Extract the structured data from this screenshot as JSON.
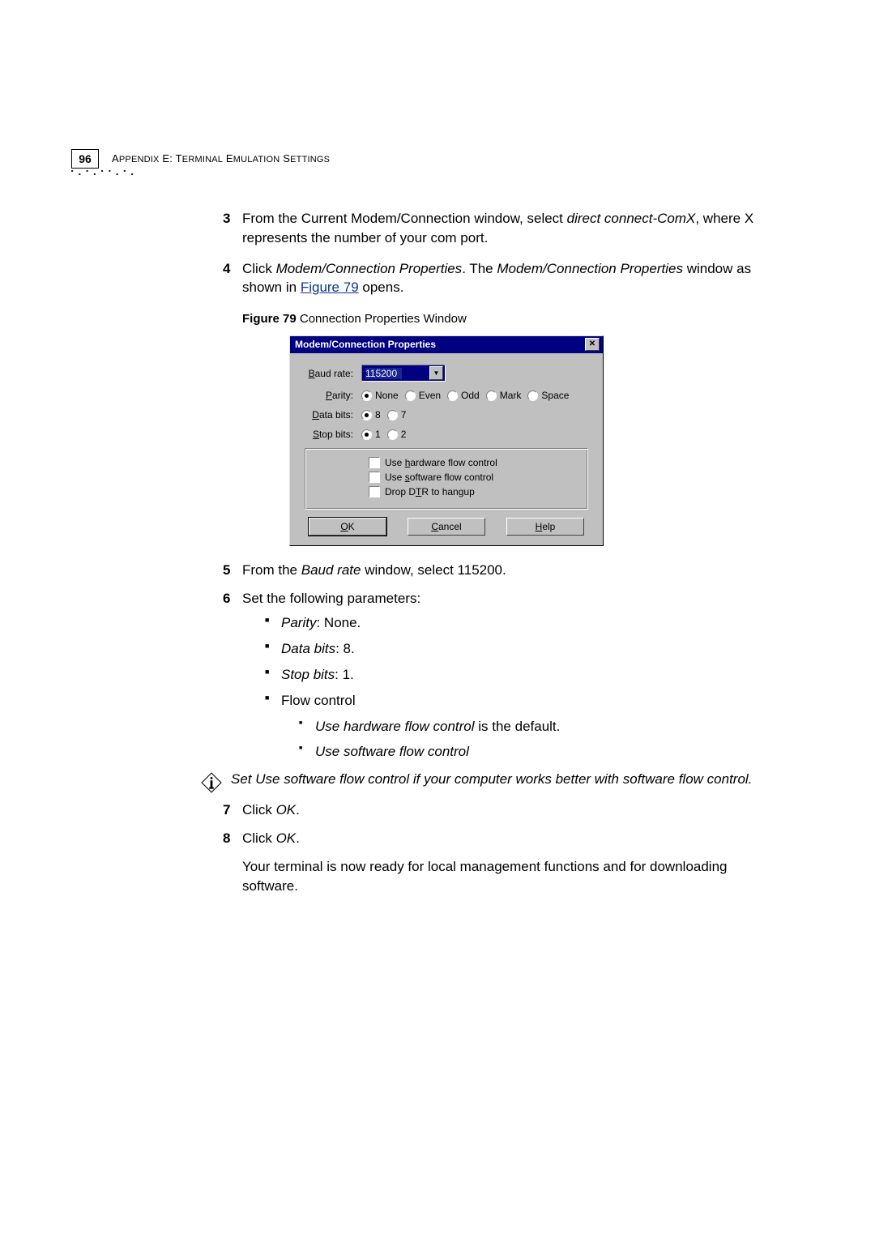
{
  "header": {
    "page_number": "96",
    "appendix_prefix": "A",
    "appendix_small": "PPENDIX",
    "appendix_letter": " E: T",
    "appendix_small2": "ERMINAL",
    "appendix_mid": " E",
    "appendix_small3": "MULATION",
    "appendix_mid2": " S",
    "appendix_small4": "ETTINGS"
  },
  "step3": {
    "prefix": "From the Current Modem/Connection window, select ",
    "italic": "direct connect-ComX",
    "suffix": ", where X represents the number of your com port."
  },
  "step4": {
    "prefix": "Click ",
    "italic1": "Modem/Connection Properties",
    "mid": ". The ",
    "italic2": "Modem/Connection Properties",
    "suffix1": " window as shown in ",
    "link": "Figure 79",
    "suffix2": " opens."
  },
  "figure": {
    "label": "Figure 79",
    "caption": "   Connection Properties Window"
  },
  "dialog": {
    "title": "Modem/Connection Properties",
    "baud_label_u": "B",
    "baud_label": "aud rate:",
    "baud_value": "115200",
    "parity_label_u": "P",
    "parity_label": "arity:",
    "parity_opts": {
      "none": "None",
      "even": "Even",
      "odd": "Odd",
      "mark": "Mark",
      "space": "Space"
    },
    "databits_label_u": "D",
    "databits_label": "ata bits:",
    "databits_opts": {
      "eight": "8",
      "seven": "7"
    },
    "stopbits_label_u": "S",
    "stopbits_label": "top bits:",
    "stopbits_opts": {
      "one": "1",
      "two": "2"
    },
    "checkboxes": {
      "hw_pre": "Use ",
      "hw_u": "h",
      "hw_post": "ardware flow control",
      "sw_pre": "Use ",
      "sw_u": "s",
      "sw_post": "oftware flow control",
      "dtr_pre": "Drop D",
      "dtr_u": "T",
      "dtr_post": "R to hangup"
    },
    "buttons": {
      "ok_u": "O",
      "ok": "K",
      "cancel_u": "C",
      "cancel": "ancel",
      "help_u": "H",
      "help": "elp"
    }
  },
  "step5": {
    "prefix": "From the ",
    "italic": "Baud rate",
    "suffix": " window, select 115200."
  },
  "step6": {
    "text": "Set the following parameters:",
    "b1_i": "Parity",
    "b1_t": ": None.",
    "b2_i": "Data bits",
    "b2_t": ": 8.",
    "b3_i": "Stop bits",
    "b3_t": ": 1.",
    "b4_t": "Flow control",
    "sb1_i": "Use hardware flow control",
    "sb1_t": " is the default.",
    "sb2_i": "Use software flow control"
  },
  "note": "Set Use software flow control if your computer works better with software flow control.",
  "step7": {
    "prefix": "Click ",
    "italic": "OK",
    "suffix": "."
  },
  "step8": {
    "prefix": "Click ",
    "italic": "OK",
    "suffix": "."
  },
  "final": "Your terminal is now ready for local management functions and for downloading software."
}
